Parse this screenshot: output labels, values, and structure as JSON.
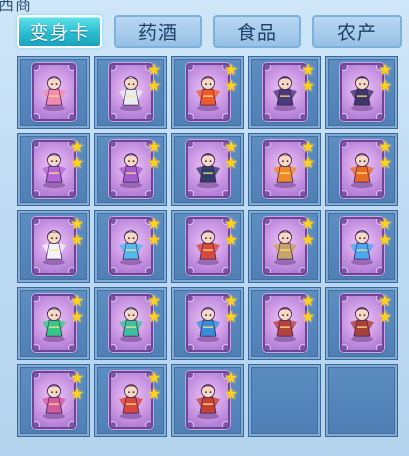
{
  "header_fragment": "西商",
  "tabs": [
    {
      "label": "变身卡",
      "active": true
    },
    {
      "label": "药酒",
      "active": false
    },
    {
      "label": "食品",
      "active": false
    },
    {
      "label": "农产",
      "active": false
    }
  ],
  "colors": {
    "accent_tab": "#2bbcd0",
    "slot": "#5d8ec2",
    "card": "#c996e3",
    "star": "#ffd21c"
  },
  "grid": {
    "columns": 5,
    "slots": [
      {
        "icon": "pink-bunny-monster-icon",
        "stars": 0,
        "hue": "#f28bb0"
      },
      {
        "icon": "white-dragon-warrior-icon",
        "stars": 2,
        "hue": "#e9eef5"
      },
      {
        "icon": "fire-lion-icon",
        "stars": 2,
        "hue": "#f05a2a"
      },
      {
        "icon": "dark-rider-icon",
        "stars": 2,
        "hue": "#4a3a7a"
      },
      {
        "icon": "shadow-knight-icon",
        "stars": 2,
        "hue": "#3e3568"
      },
      {
        "icon": "purple-dancer-icon",
        "stars": 2,
        "hue": "#b466d6"
      },
      {
        "icon": "purple-mage-icon",
        "stars": 2,
        "hue": "#a55ccf"
      },
      {
        "icon": "dark-horse-icon",
        "stars": 2,
        "hue": "#2f3e6a"
      },
      {
        "icon": "flame-phoenix-icon",
        "stars": 2,
        "hue": "#f08a2a"
      },
      {
        "icon": "fire-spirit-icon",
        "stars": 2,
        "hue": "#e76a25"
      },
      {
        "icon": "white-fairy-icon",
        "stars": 2,
        "hue": "#f4f1ff"
      },
      {
        "icon": "ice-maiden-icon",
        "stars": 2,
        "hue": "#53b8f0"
      },
      {
        "icon": "golden-warlord-icon",
        "stars": 2,
        "hue": "#d54a3a"
      },
      {
        "icon": "armored-lancer-icon",
        "stars": 2,
        "hue": "#c9a26a"
      },
      {
        "icon": "blue-flame-spirit-icon",
        "stars": 2,
        "hue": "#4aa8f2"
      },
      {
        "icon": "green-peacock-icon",
        "stars": 2,
        "hue": "#37c889"
      },
      {
        "icon": "jade-peacock-icon",
        "stars": 2,
        "hue": "#3fbfa0"
      },
      {
        "icon": "blue-sage-icon",
        "stars": 2,
        "hue": "#3a8ed8"
      },
      {
        "icon": "crimson-archer-icon",
        "stars": 2,
        "hue": "#b3423e"
      },
      {
        "icon": "red-archer-icon",
        "stars": 2,
        "hue": "#a8403a"
      },
      {
        "icon": "rainbow-bird-icon",
        "stars": 2,
        "hue": "#d25aa0"
      },
      {
        "icon": "red-samurai-icon",
        "stars": 2,
        "hue": "#d8473d"
      },
      {
        "icon": "crimson-samurai-icon",
        "stars": 2,
        "hue": "#c24236"
      },
      {
        "icon": "",
        "stars": 0,
        "hue": ""
      },
      {
        "icon": "",
        "stars": 0,
        "hue": ""
      }
    ]
  }
}
